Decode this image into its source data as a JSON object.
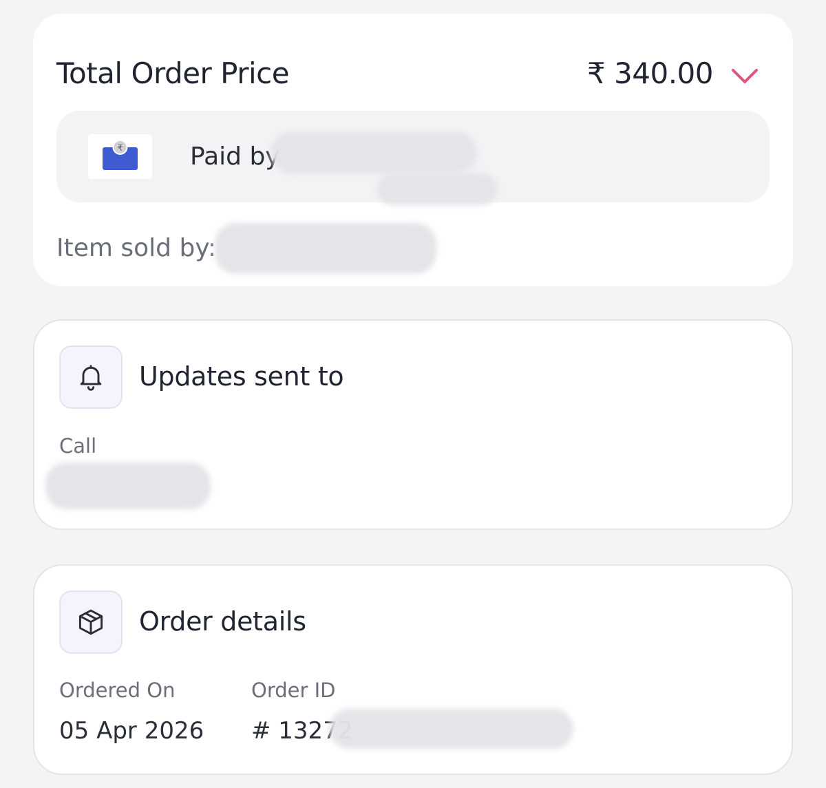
{
  "price_card": {
    "title": "Total Order Price",
    "amount": "₹ 340.00",
    "payment_text": "Paid by",
    "sold_by_text": "Item sold by:",
    "colors": {
      "chevron": "#e0567a",
      "wallet": "#3f5bd2"
    }
  },
  "updates_card": {
    "title": "Updates sent to",
    "channel_label": "Call",
    "icon": "bell-icon"
  },
  "order_card": {
    "title": "Order details",
    "icon": "package-icon",
    "ordered_on_label": "Ordered On",
    "ordered_on_value": "05 Apr 2026",
    "order_id_label": "Order ID",
    "order_id_value": "# 13272"
  }
}
